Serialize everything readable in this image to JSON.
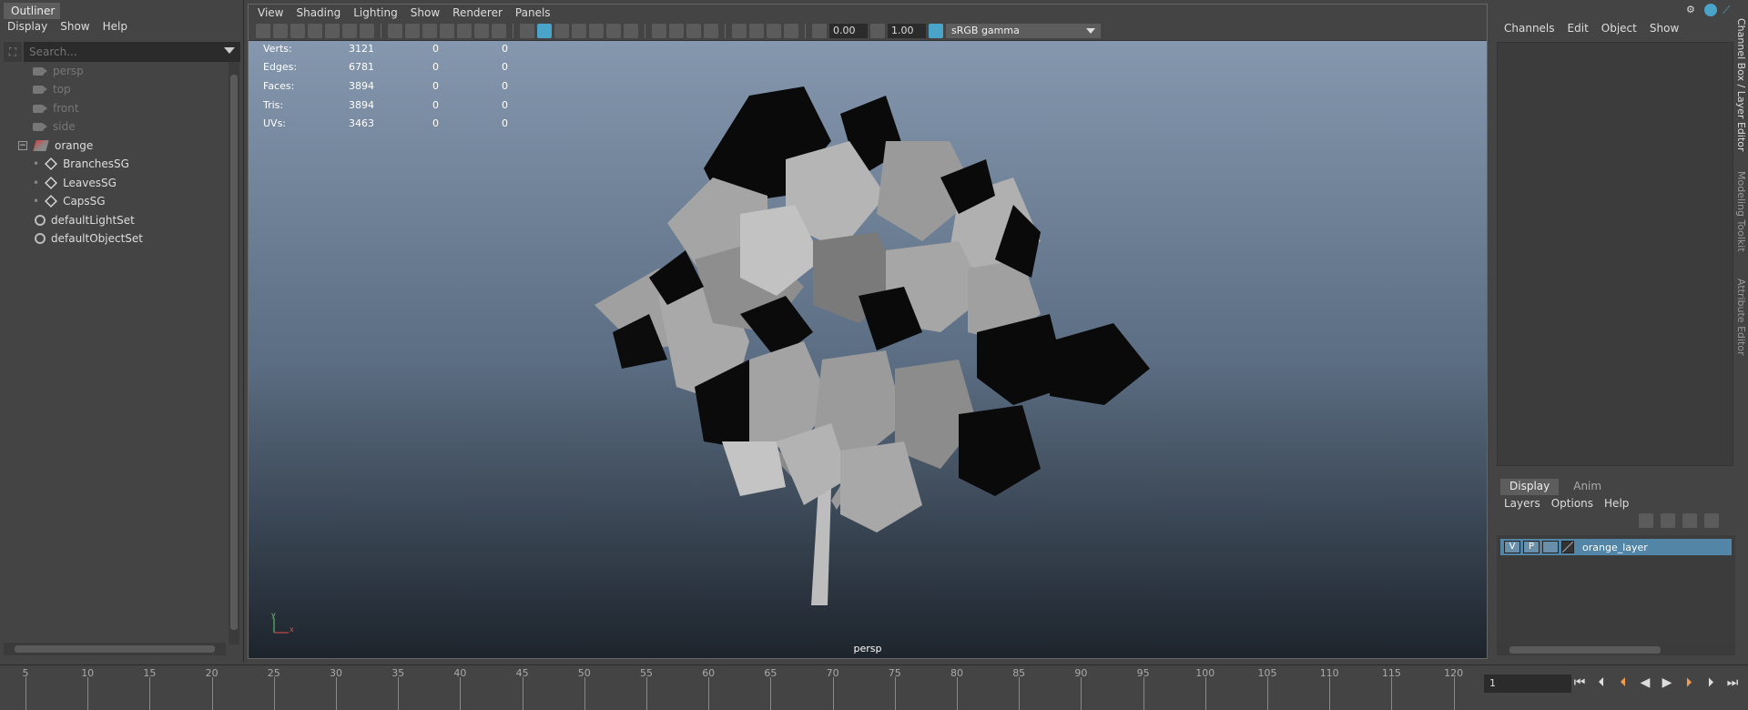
{
  "outliner": {
    "tab_title": "Outliner",
    "menu": [
      "Display",
      "Show",
      "Help"
    ],
    "search_placeholder": "Search...",
    "items": [
      {
        "label": "persp",
        "type": "camera",
        "dim": true,
        "indent": 0
      },
      {
        "label": "top",
        "type": "camera",
        "dim": true,
        "indent": 0
      },
      {
        "label": "front",
        "type": "camera",
        "dim": true,
        "indent": 0
      },
      {
        "label": "side",
        "type": "camera",
        "dim": true,
        "indent": 0
      },
      {
        "label": "orange",
        "type": "mesh",
        "dim": false,
        "indent": 0,
        "expanded": true
      },
      {
        "label": "BranchesSG",
        "type": "shading-group",
        "dim": false,
        "indent": 1
      },
      {
        "label": "LeavesSG",
        "type": "shading-group",
        "dim": false,
        "indent": 1
      },
      {
        "label": "CapsSG",
        "type": "shading-group",
        "dim": false,
        "indent": 1
      },
      {
        "label": "defaultLightSet",
        "type": "set",
        "dim": false,
        "indent": 0
      },
      {
        "label": "defaultObjectSet",
        "type": "set",
        "dim": false,
        "indent": 0
      }
    ]
  },
  "viewport": {
    "menu": [
      "View",
      "Shading",
      "Lighting",
      "Show",
      "Renderer",
      "Panels"
    ],
    "exposure": "0.00",
    "gamma_value": "1.00",
    "color_space": "sRGB gamma",
    "hud": [
      {
        "label": "Verts:",
        "v1": "3121",
        "v2": "0",
        "v3": "0"
      },
      {
        "label": "Edges:",
        "v1": "6781",
        "v2": "0",
        "v3": "0"
      },
      {
        "label": "Faces:",
        "v1": "3894",
        "v2": "0",
        "v3": "0"
      },
      {
        "label": "Tris:",
        "v1": "3894",
        "v2": "0",
        "v3": "0"
      },
      {
        "label": "UVs:",
        "v1": "3463",
        "v2": "0",
        "v3": "0"
      }
    ],
    "camera_label": "persp",
    "axis": {
      "y": "y",
      "x": "x"
    }
  },
  "channel_box": {
    "menu": [
      "Channels",
      "Edit",
      "Object",
      "Show"
    ],
    "side_tabs": [
      "Channel Box / Layer Editor",
      "Modeling Toolkit",
      "Attribute Editor"
    ]
  },
  "layer_editor": {
    "tabs": [
      "Display",
      "Anim"
    ],
    "active_tab": "Display",
    "menu": [
      "Layers",
      "Options",
      "Help"
    ],
    "layer": {
      "visible": "V",
      "playback": "P",
      "name": "orange_layer"
    }
  },
  "timeline": {
    "labels": [
      "5",
      "10",
      "15",
      "20",
      "25",
      "30",
      "35",
      "40",
      "45",
      "50",
      "55",
      "60",
      "65",
      "70",
      "75",
      "80",
      "85",
      "90",
      "95",
      "100",
      "105",
      "110",
      "115",
      "120"
    ],
    "current_frame": "1"
  },
  "colors": {
    "accent": "#4aa3c8",
    "layer_highlight": "#5285a6",
    "playhead": "#f39c4f"
  }
}
